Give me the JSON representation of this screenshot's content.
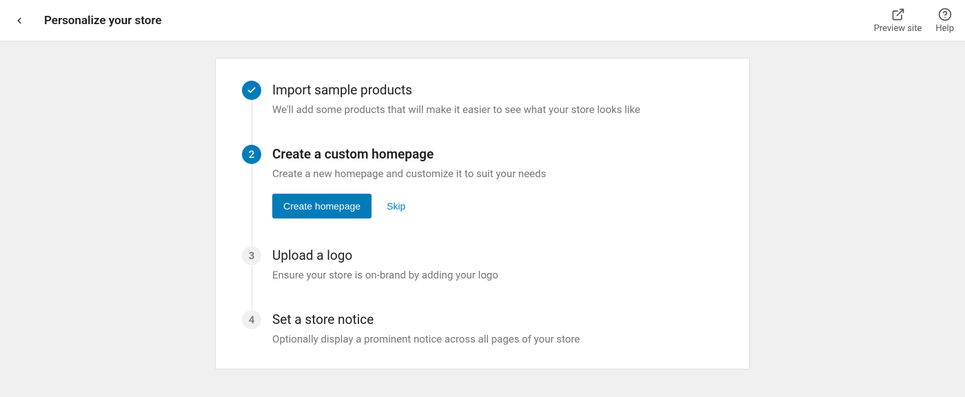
{
  "header": {
    "title": "Personalize your store",
    "preview_label": "Preview site",
    "help_label": "Help"
  },
  "steps": [
    {
      "number": "1",
      "status": "done",
      "title": "Import sample products",
      "description": "We'll add some products that will make it easier to see what your store looks like"
    },
    {
      "number": "2",
      "status": "active",
      "title": "Create a custom homepage",
      "description": "Create a new homepage and customize it to suit your needs",
      "primary_action": "Create homepage",
      "secondary_action": "Skip"
    },
    {
      "number": "3",
      "status": "pending",
      "title": "Upload a logo",
      "description": "Ensure your store is on-brand by adding your logo"
    },
    {
      "number": "4",
      "status": "pending",
      "title": "Set a store notice",
      "description": "Optionally display a prominent notice across all pages of your store"
    }
  ]
}
